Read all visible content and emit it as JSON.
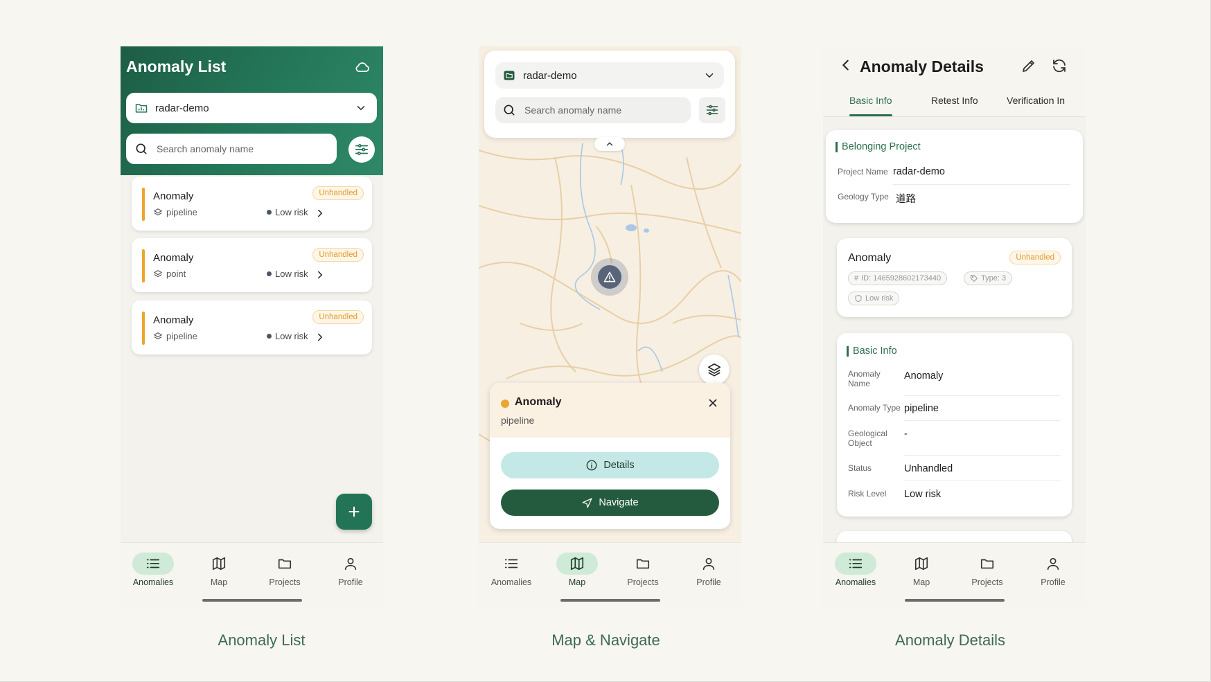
{
  "nav": {
    "anomalies": "Anomalies",
    "map": "Map",
    "projects": "Projects",
    "profile": "Profile"
  },
  "screen1": {
    "caption": "Anomaly List",
    "title": "Anomaly List",
    "project": "radar-demo",
    "search_placeholder": "Search anomaly name",
    "cards": [
      {
        "name": "Anomaly",
        "type": "pipeline",
        "risk": "Low risk",
        "status": "Unhandled"
      },
      {
        "name": "Anomaly",
        "type": "point",
        "risk": "Low risk",
        "status": "Unhandled"
      },
      {
        "name": "Anomaly",
        "type": "pipeline",
        "risk": "Low risk",
        "status": "Unhandled"
      }
    ]
  },
  "screen2": {
    "caption": "Map & Navigate",
    "project": "radar-demo",
    "search_placeholder": "Search anomaly name",
    "popup": {
      "title": "Anomaly",
      "subtitle": "pipeline",
      "details_label": "Details",
      "navigate_label": "Navigate"
    }
  },
  "screen3": {
    "caption": "Anomaly Details",
    "title": "Anomaly Details",
    "tabs": [
      "Basic Info",
      "Retest Info",
      "Verification In"
    ],
    "belonging": {
      "section_title": "Belonging Project",
      "project_name_label": "Project Name",
      "project_name": "radar-demo",
      "geology_type_label": "Geology Type",
      "geology_type": "道路"
    },
    "summary": {
      "name": "Anomaly",
      "status": "Unhandled",
      "id_chip": "ID: 1465928602173440",
      "type_chip": "Type: 3",
      "risk_chip": "Low risk"
    },
    "basic": {
      "section_title": "Basic Info",
      "rows": [
        {
          "label": "Anomaly Name",
          "value": "Anomaly"
        },
        {
          "label": "Anomaly Type",
          "value": "pipeline"
        },
        {
          "label": "Geological Object",
          "value": "-"
        },
        {
          "label": "Status",
          "value": "Unhandled"
        },
        {
          "label": "Risk Level",
          "value": "Low risk"
        }
      ]
    }
  },
  "colors": {
    "brand_green": "#237456",
    "dark_green": "#245b3e",
    "accent_orange": "#eba62d",
    "details_teal": "#c4e8e5"
  }
}
